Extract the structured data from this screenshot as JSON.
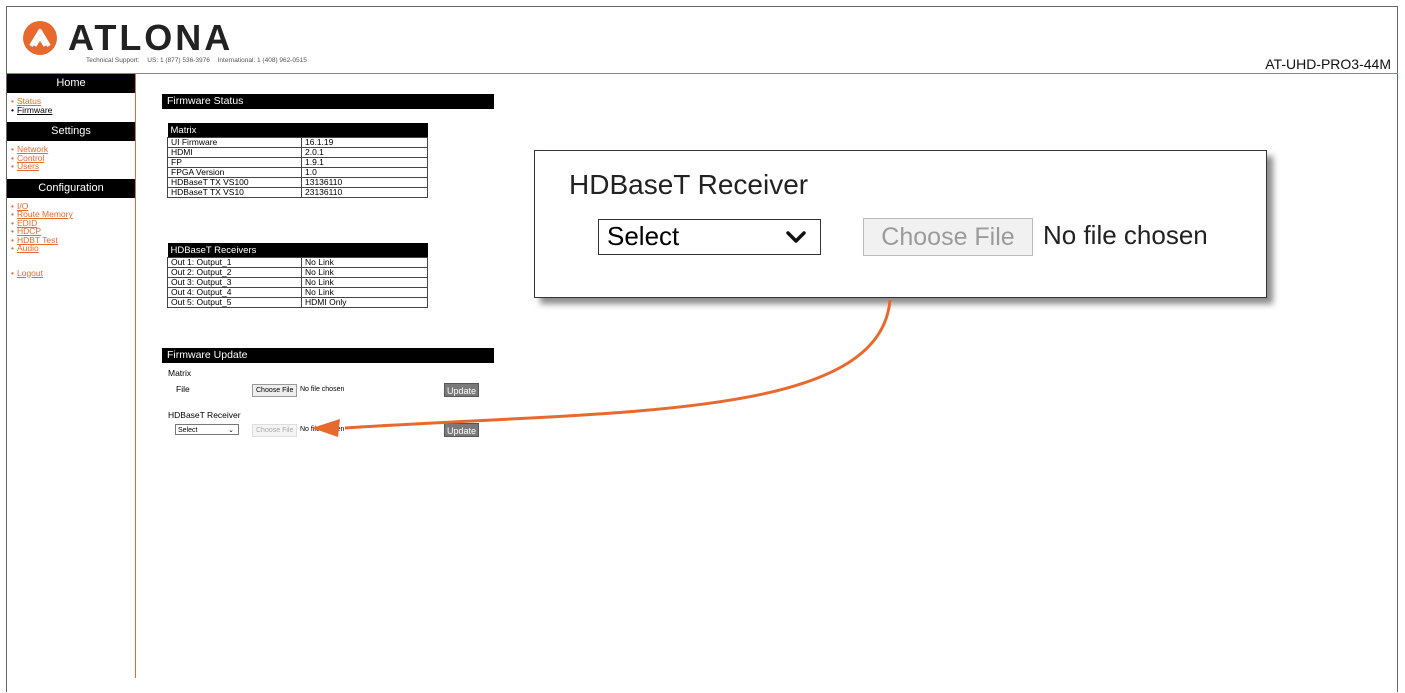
{
  "brand": {
    "name": "ATLONA",
    "accent": "#e8692d"
  },
  "support": {
    "label": "Technical Support:",
    "us": "US: 1 (877) 536-3976",
    "intl": "International: 1 (408) 962-0515"
  },
  "model": "AT-UHD-PRO3-44M",
  "sidebar": {
    "home": "Home",
    "home_items": [
      {
        "label": "Status"
      },
      {
        "label": "Firmware"
      }
    ],
    "settings": "Settings",
    "settings_items": [
      {
        "label": "Network"
      },
      {
        "label": "Control"
      },
      {
        "label": "Users"
      }
    ],
    "configuration": "Configuration",
    "config_items": [
      {
        "label": "I/O"
      },
      {
        "label": "Route Memory"
      },
      {
        "label": "EDID"
      },
      {
        "label": "HDCP"
      },
      {
        "label": "HDBT Test"
      },
      {
        "label": "Audio"
      }
    ],
    "logout": "Logout"
  },
  "firmware_status": {
    "title": "Firmware Status",
    "matrix_header": "Matrix",
    "matrix_rows": [
      {
        "k": "UI Firmware",
        "v": "16.1.19"
      },
      {
        "k": "HDMI",
        "v": "2.0.1"
      },
      {
        "k": "FP",
        "v": "1.9.1"
      },
      {
        "k": "FPGA Version",
        "v": "1.0"
      },
      {
        "k": "HDBaseT TX VS100",
        "v": "13136110"
      },
      {
        "k": "HDBaseT TX VS10",
        "v": "23136110"
      }
    ],
    "receivers_header": "HDBaseT Receivers",
    "receiver_rows": [
      {
        "k": "Out 1: Output_1",
        "v": "No Link"
      },
      {
        "k": "Out 2: Output_2",
        "v": "No Link"
      },
      {
        "k": "Out 3: Output_3",
        "v": "No Link"
      },
      {
        "k": "Out 4: Output_4",
        "v": "No Link"
      },
      {
        "k": "Out 5: Output_5",
        "v": "HDMI Only"
      }
    ]
  },
  "firmware_update": {
    "title": "Firmware Update",
    "matrix_label": "Matrix",
    "file_label": "File",
    "choose_file": "Choose File",
    "no_file": "No file chosen",
    "update": "Update",
    "receiver_label": "HDBaseT Receiver",
    "select": "Select",
    "receiver_choose_file": "Choose File",
    "receiver_no_file": "No file chosen",
    "receiver_update": "Update"
  },
  "callout": {
    "title": "HDBaseT Receiver",
    "select": "Select",
    "choose_file": "Choose File",
    "no_file": "No file chosen"
  }
}
